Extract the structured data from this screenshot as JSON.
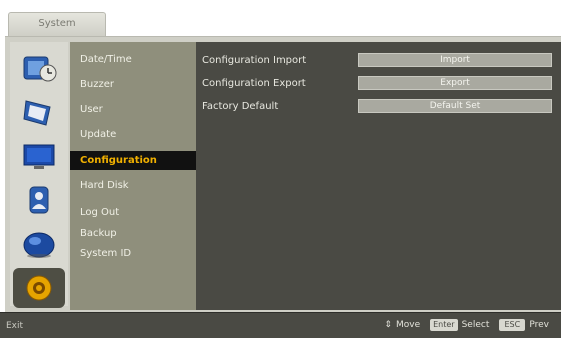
{
  "tab": {
    "label": "System"
  },
  "menu": {
    "items": [
      {
        "label": "Date/Time"
      },
      {
        "label": "Buzzer"
      },
      {
        "label": "User"
      },
      {
        "label": "Update"
      },
      {
        "label": "Configuration"
      },
      {
        "label": "Hard Disk"
      },
      {
        "label": "Log Out"
      },
      {
        "label": "Backup"
      },
      {
        "label": "System ID"
      }
    ],
    "active_index": 4
  },
  "content": {
    "rows": [
      {
        "label": "Configuration Import",
        "button": "Import"
      },
      {
        "label": "Configuration Export",
        "button": "Export"
      },
      {
        "label": "Factory Default",
        "button": "Default Set"
      }
    ]
  },
  "icons": [
    {
      "name": "date-time-icon"
    },
    {
      "name": "display-icon"
    },
    {
      "name": "monitor-icon"
    },
    {
      "name": "user-icon"
    },
    {
      "name": "network-globe-icon"
    },
    {
      "name": "system-gear-icon",
      "selected": true
    }
  ],
  "status_bar": {
    "exit": "Exit",
    "move": "Move",
    "enter_key": "Enter",
    "select": "Select",
    "prev_key": "ESC",
    "prev": "Prev"
  },
  "colors": {
    "menu_bg": "#8f8f7c",
    "content_bg": "#4a4a44",
    "active_item_bg": "#111111",
    "active_item_text": "#f0b000"
  }
}
